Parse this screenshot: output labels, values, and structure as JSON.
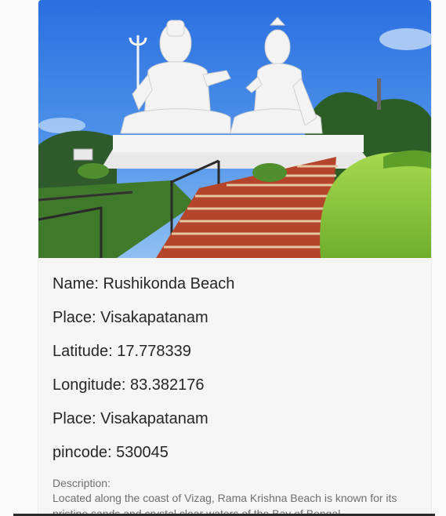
{
  "place_card": {
    "image_alt": "Statues of Shiva and Parvati at Kailasagiri",
    "name_line": "Name: Rushikonda Beach",
    "place_line": "Place: Visakapatanam",
    "latitude_line": "Latitude: 17.778339",
    "longitude_line": "Longitude: 83.382176",
    "place_line_2": "Place: Visakapatanam",
    "pincode_line": "pincode: 530045",
    "description_label": "Description:",
    "description_text": "Located along the coast of Vizag, Rama Krishna Beach is known for its pristine sands and crystal clear waters of the Bay of Bengal"
  },
  "colors": {
    "sky": "#3a7be0",
    "foliage": "#8cc63f",
    "steps": "#b5452a",
    "statue": "#f2f2f2"
  }
}
